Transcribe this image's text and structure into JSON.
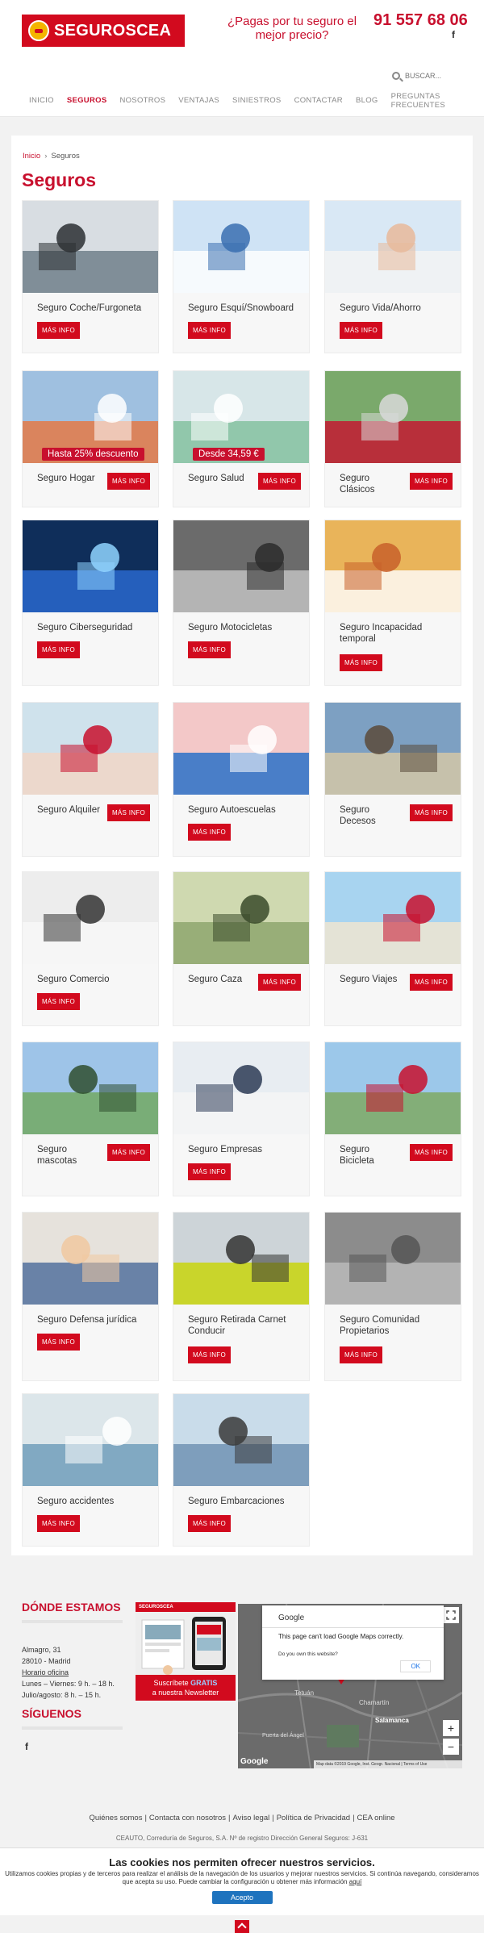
{
  "header": {
    "logo_text": "SEGUROSCEA",
    "tagline": "¿Pagas por tu seguro el mejor precio?",
    "phone": "91 557 68 06",
    "facebook_icon": "f"
  },
  "search": {
    "placeholder": "BUSCAR..."
  },
  "nav": [
    "INICIO",
    "SEGUROS",
    "NOSOTROS",
    "VENTAJAS",
    "SINIESTROS",
    "CONTACTAR",
    "BLOG",
    "PREGUNTAS FRECUENTES"
  ],
  "breadcrumb": {
    "home": "Inicio",
    "sep": "›",
    "current": "Seguros"
  },
  "page_title": "Seguros",
  "more_info_label": "MÁS INFO",
  "cards": [
    {
      "title": "Seguro Coche/Furgoneta",
      "promo": ""
    },
    {
      "title": "Seguro Esquí/Snowboard",
      "promo": ""
    },
    {
      "title": "Seguro Vida/Ahorro",
      "promo": ""
    },
    {
      "title": "Seguro Hogar",
      "promo": "Hasta 25% descuento"
    },
    {
      "title": "Seguro Salud",
      "promo": "Desde 34,59 €"
    },
    {
      "title": "Seguro Clásicos",
      "promo": ""
    },
    {
      "title": "Seguro Ciberseguridad",
      "promo": ""
    },
    {
      "title": "Seguro Motocicletas",
      "promo": ""
    },
    {
      "title": "Seguro Incapacidad temporal",
      "promo": ""
    },
    {
      "title": "Seguro Alquiler",
      "promo": ""
    },
    {
      "title": "Seguro Autoescuelas",
      "promo": ""
    },
    {
      "title": "Seguro Decesos",
      "promo": ""
    },
    {
      "title": "Seguro Comercio",
      "promo": ""
    },
    {
      "title": "Seguro Caza",
      "promo": ""
    },
    {
      "title": "Seguro Viajes",
      "promo": ""
    },
    {
      "title": "Seguro mascotas",
      "promo": ""
    },
    {
      "title": "Seguro Empresas",
      "promo": ""
    },
    {
      "title": "Seguro Bicicleta",
      "promo": ""
    },
    {
      "title": "Seguro Defensa jurídica",
      "promo": ""
    },
    {
      "title": "Seguro Retirada Carnet Conducir",
      "promo": ""
    },
    {
      "title": "Seguro Comunidad Propietarios",
      "promo": ""
    },
    {
      "title": "Seguro accidentes",
      "promo": ""
    },
    {
      "title": "Seguro Embarcaciones",
      "promo": ""
    }
  ],
  "location": {
    "title": "DÓNDE ESTAMOS",
    "street": "Almagro, 31",
    "city": "28010 - Madrid",
    "hours_link": "Horario oficina",
    "hours_1": "Lunes – Viernes: 9 h. – 18 h.",
    "hours_2": "Julio/agosto: 8 h. – 15 h."
  },
  "follow": {
    "title": "SÍGUENOS",
    "facebook_icon": "f"
  },
  "newsletter": {
    "brand": "SEGUROSCEA",
    "line1": "Suscríbete",
    "highlight": "GRATIS",
    "line2": "a nuestra Newsletter"
  },
  "map": {
    "google_label": "Google",
    "error_title": "This page can't load Google Maps correctly.",
    "question": "Do you own this website?",
    "ok": "OK",
    "place_1": "Tetuán",
    "place_2": "Chamartín",
    "place_3": "Salamanca",
    "place_4": "Puerta del Ángel",
    "attribution": "Map data ©2019 Google, Inst. Geogr. Nacional  |  Terms of Use",
    "zoom_in": "+",
    "zoom_out": "−"
  },
  "footer": {
    "links": [
      "Quiénes somos",
      "Contacta con nosotros",
      "Aviso legal",
      "Política de Privacidad",
      "CEA online"
    ],
    "link_sep": "|",
    "legal": "CEAUTO, Correduría de Seguros, S.A. Nº de registro Dirección General Seguros: J-631"
  },
  "cookies": {
    "title": "Las cookies nos permiten ofrecer nuestros servicios.",
    "text": "Utilizamos cookies propias y de terceros para realizar el análisis de la navegación de los usuarios y mejorar nuestros servicios. Si continúa navegando, consideramos que acepta su uso. Puede cambiar la configuración u obtener más información",
    "link": "aquí",
    "accept": "Acepto"
  },
  "colors": {
    "brand_red": "#c8102e",
    "button_red": "#d20a1e",
    "cookie_blue": "#1e73be"
  }
}
